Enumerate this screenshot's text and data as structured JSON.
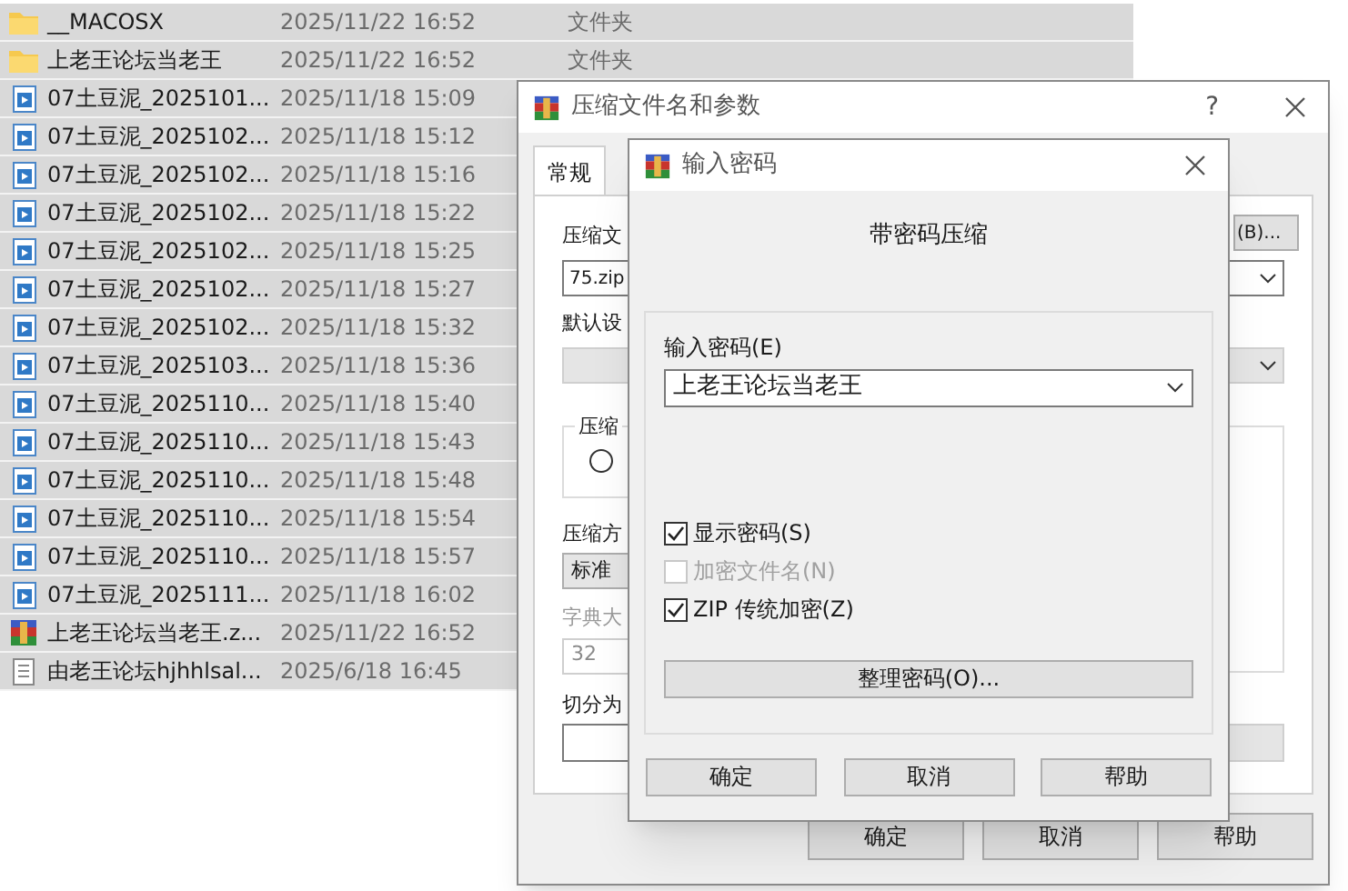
{
  "file_list": {
    "rows": [
      {
        "kind": "folder",
        "name": "__MACOSX",
        "date": "2025/11/22 16:52",
        "type": "文件夹",
        "selected": true
      },
      {
        "kind": "folder",
        "name": "上老王论坛当老王",
        "date": "2025/11/22 16:52",
        "type": "文件夹",
        "selected": true
      },
      {
        "kind": "video",
        "name": "07土豆泥_2025101...",
        "date": "2025/11/18 15:09",
        "selected": true
      },
      {
        "kind": "video",
        "name": "07土豆泥_2025102...",
        "date": "2025/11/18 15:12",
        "selected": true
      },
      {
        "kind": "video",
        "name": "07土豆泥_2025102...",
        "date": "2025/11/18 15:16",
        "selected": true
      },
      {
        "kind": "video",
        "name": "07土豆泥_2025102...",
        "date": "2025/11/18 15:22",
        "selected": true
      },
      {
        "kind": "video",
        "name": "07土豆泥_2025102...",
        "date": "2025/11/18 15:25",
        "selected": true
      },
      {
        "kind": "video",
        "name": "07土豆泥_2025102...",
        "date": "2025/11/18 15:27",
        "selected": true
      },
      {
        "kind": "video",
        "name": "07土豆泥_2025102...",
        "date": "2025/11/18 15:32",
        "selected": true
      },
      {
        "kind": "video",
        "name": "07土豆泥_2025103...",
        "date": "2025/11/18 15:36",
        "selected": true
      },
      {
        "kind": "video",
        "name": "07土豆泥_2025110...",
        "date": "2025/11/18 15:40",
        "selected": true
      },
      {
        "kind": "video",
        "name": "07土豆泥_2025110...",
        "date": "2025/11/18 15:43",
        "selected": true
      },
      {
        "kind": "video",
        "name": "07土豆泥_2025110...",
        "date": "2025/11/18 15:48",
        "selected": true
      },
      {
        "kind": "video",
        "name": "07土豆泥_2025110...",
        "date": "2025/11/18 15:54",
        "selected": true
      },
      {
        "kind": "video",
        "name": "07土豆泥_2025110...",
        "date": "2025/11/18 15:57",
        "selected": true
      },
      {
        "kind": "video",
        "name": "07土豆泥_2025111...",
        "date": "2025/11/18 16:02",
        "selected": true
      },
      {
        "kind": "archive",
        "name": "上老王论坛当老王.z...",
        "date": "2025/11/22 16:52",
        "selected": true
      },
      {
        "kind": "text",
        "name": "由老王论坛hjhhlsal...",
        "date": "2025/6/18 16:45",
        "selected": true
      }
    ]
  },
  "compress_dialog": {
    "title": "压缩文件名和参数",
    "help": "?",
    "tabs": [
      {
        "label": "常规",
        "selected": true
      }
    ],
    "archive_name_label": "压缩文",
    "browse_button": "(B)...",
    "archive_name": "75.zip",
    "profile": {
      "label": "默认设",
      "disabled": true
    },
    "format_group_label": "压缩",
    "format_option": {
      "selected": false
    },
    "method_label": "压缩方",
    "method": "标准",
    "dictionary": {
      "label": "字典大",
      "value": "32",
      "disabled": true
    },
    "split_label": "切分为",
    "buttons": [
      "确定",
      "取消",
      "帮助"
    ]
  },
  "password_dialog": {
    "title": "输入密码",
    "heading": "带密码压缩",
    "password_label": "输入密码(E)",
    "password": "上老王论坛当老王",
    "options": [
      {
        "label": "显示密码(S)",
        "checked": true,
        "disabled": false
      },
      {
        "label": "加密文件名(N)",
        "checked": false,
        "disabled": true
      },
      {
        "label": "ZIP 传统加密(Z)",
        "checked": true,
        "disabled": false
      }
    ],
    "organize_button": "整理密码(O)...",
    "buttons": [
      "确定",
      "取消",
      "帮助"
    ]
  }
}
